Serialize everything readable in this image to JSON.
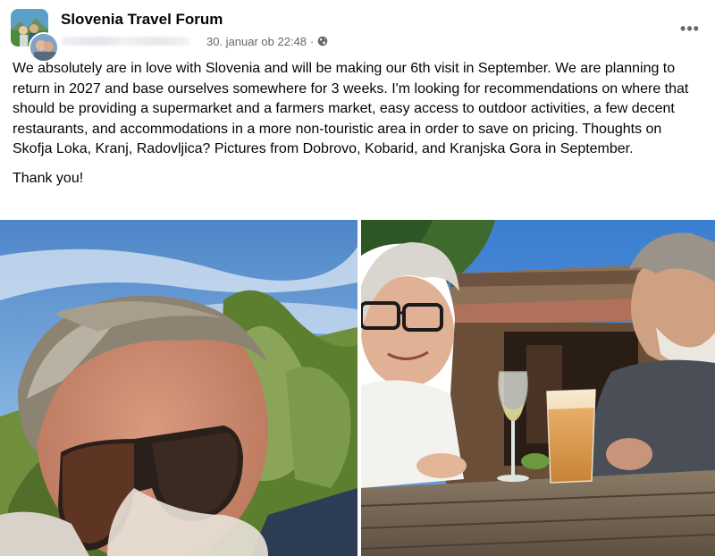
{
  "post": {
    "group_name": "Slovenia Travel Forum",
    "timestamp": "30. januar ob 22:48",
    "separator": "·",
    "privacy_icon": "globe-icon",
    "more_icon": "more-options-icon",
    "more_label": "•••",
    "body": "We absolutely are in love with Slovenia and will be making our 6th visit in September.  We are planning to return in 2027 and base ourselves somewhere for 3 weeks.  I'm looking for recommendations on where that should be providing a supermarket and a farmers market, easy access to outdoor activities, a few decent restaurants, and accommodations in a more non-touristic area in order to save on pricing.  Thoughts on Skofja Loka, Kranj, Radovljica? Pictures from Dobrovo, Kobarid, and Kranjska Gora in September.",
    "thanks": "Thank you!"
  },
  "colors": {
    "primary_text": "#050505",
    "secondary_text": "#65676b",
    "background": "#ffffff"
  }
}
